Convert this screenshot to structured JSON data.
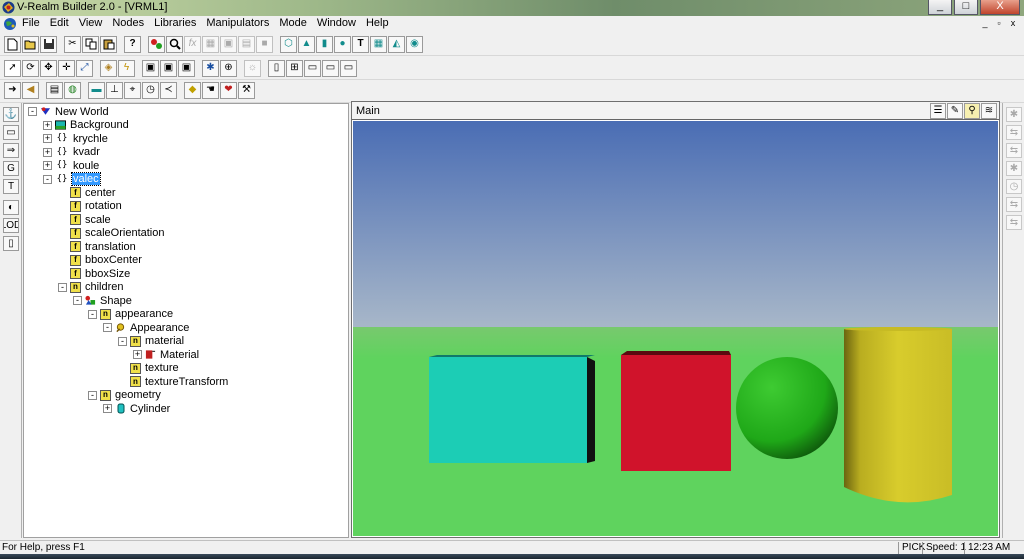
{
  "window": {
    "title": "V-Realm Builder 2.0 - [VRML1]",
    "minimize_label": "_",
    "maximize_label": "□",
    "close_label": "X"
  },
  "menubar": {
    "items": [
      "File",
      "Edit",
      "View",
      "Nodes",
      "Libraries",
      "Manipulators",
      "Mode",
      "Window",
      "Help"
    ],
    "mdi": [
      "_",
      "▫",
      "x"
    ]
  },
  "tree": {
    "nodes": [
      {
        "label": "New World",
        "level": 0,
        "expander": "-",
        "icon": "world-icon",
        "kind": "world"
      },
      {
        "label": "Background",
        "level": 1,
        "expander": "+",
        "icon": "background-icon",
        "kind": "background"
      },
      {
        "label": "krychle",
        "level": 1,
        "expander": "+",
        "icon": "transform-icon",
        "kind": "transform"
      },
      {
        "label": "kvadr",
        "level": 1,
        "expander": "+",
        "icon": "transform-icon",
        "kind": "transform"
      },
      {
        "label": "koule",
        "level": 1,
        "expander": "+",
        "icon": "transform-icon",
        "kind": "transform"
      },
      {
        "label": "valec",
        "level": 1,
        "expander": "-",
        "icon": "transform-icon",
        "kind": "transform",
        "selected": true
      },
      {
        "label": "center",
        "level": 2,
        "expander": "",
        "icon": "field-icon",
        "kind": "field"
      },
      {
        "label": "rotation",
        "level": 2,
        "expander": "",
        "icon": "field-icon",
        "kind": "field"
      },
      {
        "label": "scale",
        "level": 2,
        "expander": "",
        "icon": "field-icon",
        "kind": "field"
      },
      {
        "label": "scaleOrientation",
        "level": 2,
        "expander": "",
        "icon": "field-icon",
        "kind": "field"
      },
      {
        "label": "translation",
        "level": 2,
        "expander": "",
        "icon": "field-icon",
        "kind": "field"
      },
      {
        "label": "bboxCenter",
        "level": 2,
        "expander": "",
        "icon": "field-icon",
        "kind": "field"
      },
      {
        "label": "bboxSize",
        "level": 2,
        "expander": "",
        "icon": "field-icon",
        "kind": "field"
      },
      {
        "label": "children",
        "level": 2,
        "expander": "-",
        "icon": "multi-field-icon",
        "kind": "mfield"
      },
      {
        "label": "Shape",
        "level": 3,
        "expander": "-",
        "icon": "shape-icon",
        "kind": "shape"
      },
      {
        "label": "appearance",
        "level": 4,
        "expander": "-",
        "icon": "node-field-icon",
        "kind": "mfield"
      },
      {
        "label": "Appearance",
        "level": 5,
        "expander": "-",
        "icon": "appearance-icon",
        "kind": "appearance"
      },
      {
        "label": "material",
        "level": 6,
        "expander": "-",
        "icon": "node-field-icon",
        "kind": "mfield"
      },
      {
        "label": "Material",
        "level": 7,
        "expander": "+",
        "icon": "material-icon",
        "kind": "material"
      },
      {
        "label": "texture",
        "level": 6,
        "expander": "",
        "icon": "node-field-icon",
        "kind": "mfield"
      },
      {
        "label": "textureTransform",
        "level": 6,
        "expander": "",
        "icon": "node-field-icon",
        "kind": "mfield"
      },
      {
        "label": "geometry",
        "level": 4,
        "expander": "-",
        "icon": "node-field-icon",
        "kind": "mfield"
      },
      {
        "label": "Cylinder",
        "level": 5,
        "expander": "+",
        "icon": "cylinder-icon",
        "kind": "cylinder"
      }
    ]
  },
  "viewport": {
    "title": "Main"
  },
  "statusbar": {
    "help": "For Help, press F1",
    "mode": "PICK",
    "speed": "Speed: 1",
    "time": "12:23 AM"
  },
  "scene_colors": {
    "sky_top": "#4a6db4",
    "sky_bottom": "#a9b8c9",
    "ground": "#5fd35e",
    "box_cyan": "#1ccdb5",
    "box_red": "#d0132b",
    "sphere": "#22b51c",
    "cylinder": "#d4c82a"
  }
}
